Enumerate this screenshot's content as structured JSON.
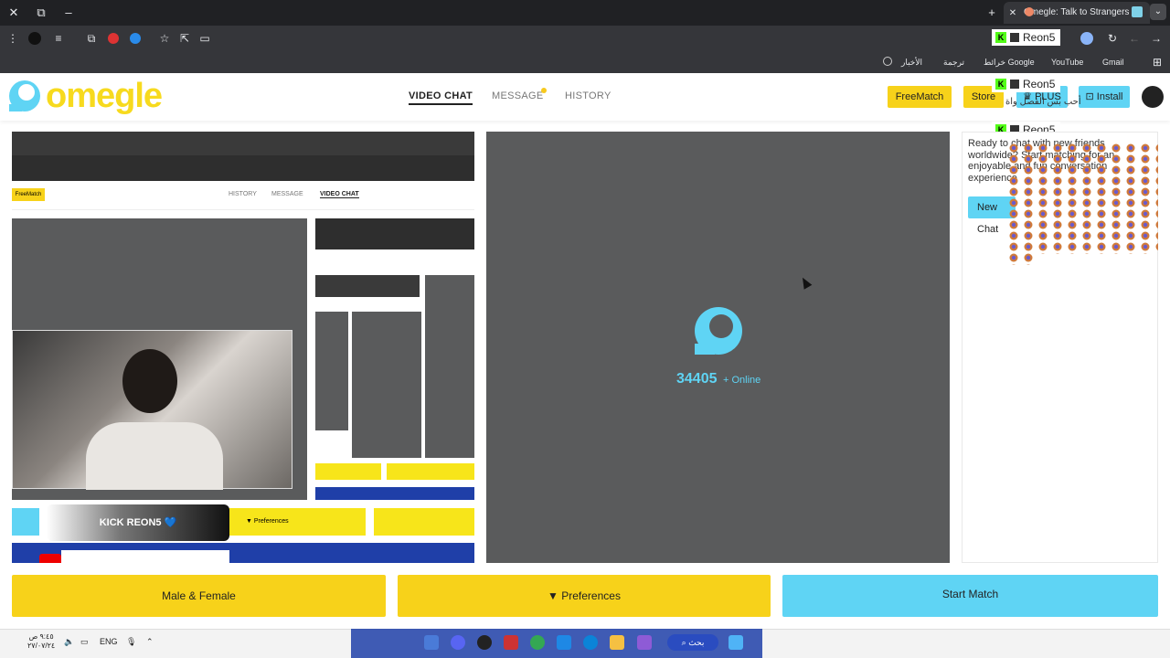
{
  "browser": {
    "tab_title": "Omegle: Talk to Strangers w",
    "bookmarks": [
      "Gmail",
      "YouTube",
      "خرائط Google",
      "ترجمة",
      "الأخبار"
    ],
    "controls": {
      "close": "✕",
      "restore": "⧉",
      "minimize": "–",
      "new_tab": "+",
      "tab_close": "✕",
      "menu": "⋮",
      "star": "☆",
      "reload": "↻",
      "back": "←",
      "forward": "→",
      "apps": "⊞"
    }
  },
  "overlay": {
    "name": "Reon5",
    "kick_badge": "K",
    "kick_banner": "KICK REON5 💙",
    "header_overlay_text": "أحب بس الفصل واة"
  },
  "site": {
    "logo_text": "omegle",
    "nav": [
      {
        "label": "VIDEO CHAT",
        "active": true
      },
      {
        "label": "MESSAGE",
        "active": false
      },
      {
        "label": "HISTORY",
        "active": false
      }
    ],
    "buttons": {
      "freematch": "FreeMatch",
      "store": "Store",
      "plus": "PLUS",
      "install": "Install"
    }
  },
  "stranger": {
    "online_count": "34405",
    "online_label": "+ Online"
  },
  "side": {
    "intro": "Ready to chat with new friends worldwide? Start matching for an enjoyable and fun conversation experience",
    "new_chat": "New Chat"
  },
  "mini": {
    "video_chat": "VIDEO CHAT",
    "message": "MESSAGE",
    "history": "HISTORY",
    "freematch": "FreeMatch",
    "preferences": "Preferences"
  },
  "bottom": {
    "gender": "Male & Female",
    "preferences": "Preferences",
    "start": "Start Match"
  },
  "taskbar": {
    "lang": "ENG",
    "time": "٩:٤٥ ص",
    "date": "٢٧/٠٧/٢٤",
    "search": "بحث"
  },
  "colors": {
    "yellow": "#f7d21a",
    "cyan": "#5fd4f4",
    "panel_gray": "#5a5b5c"
  }
}
